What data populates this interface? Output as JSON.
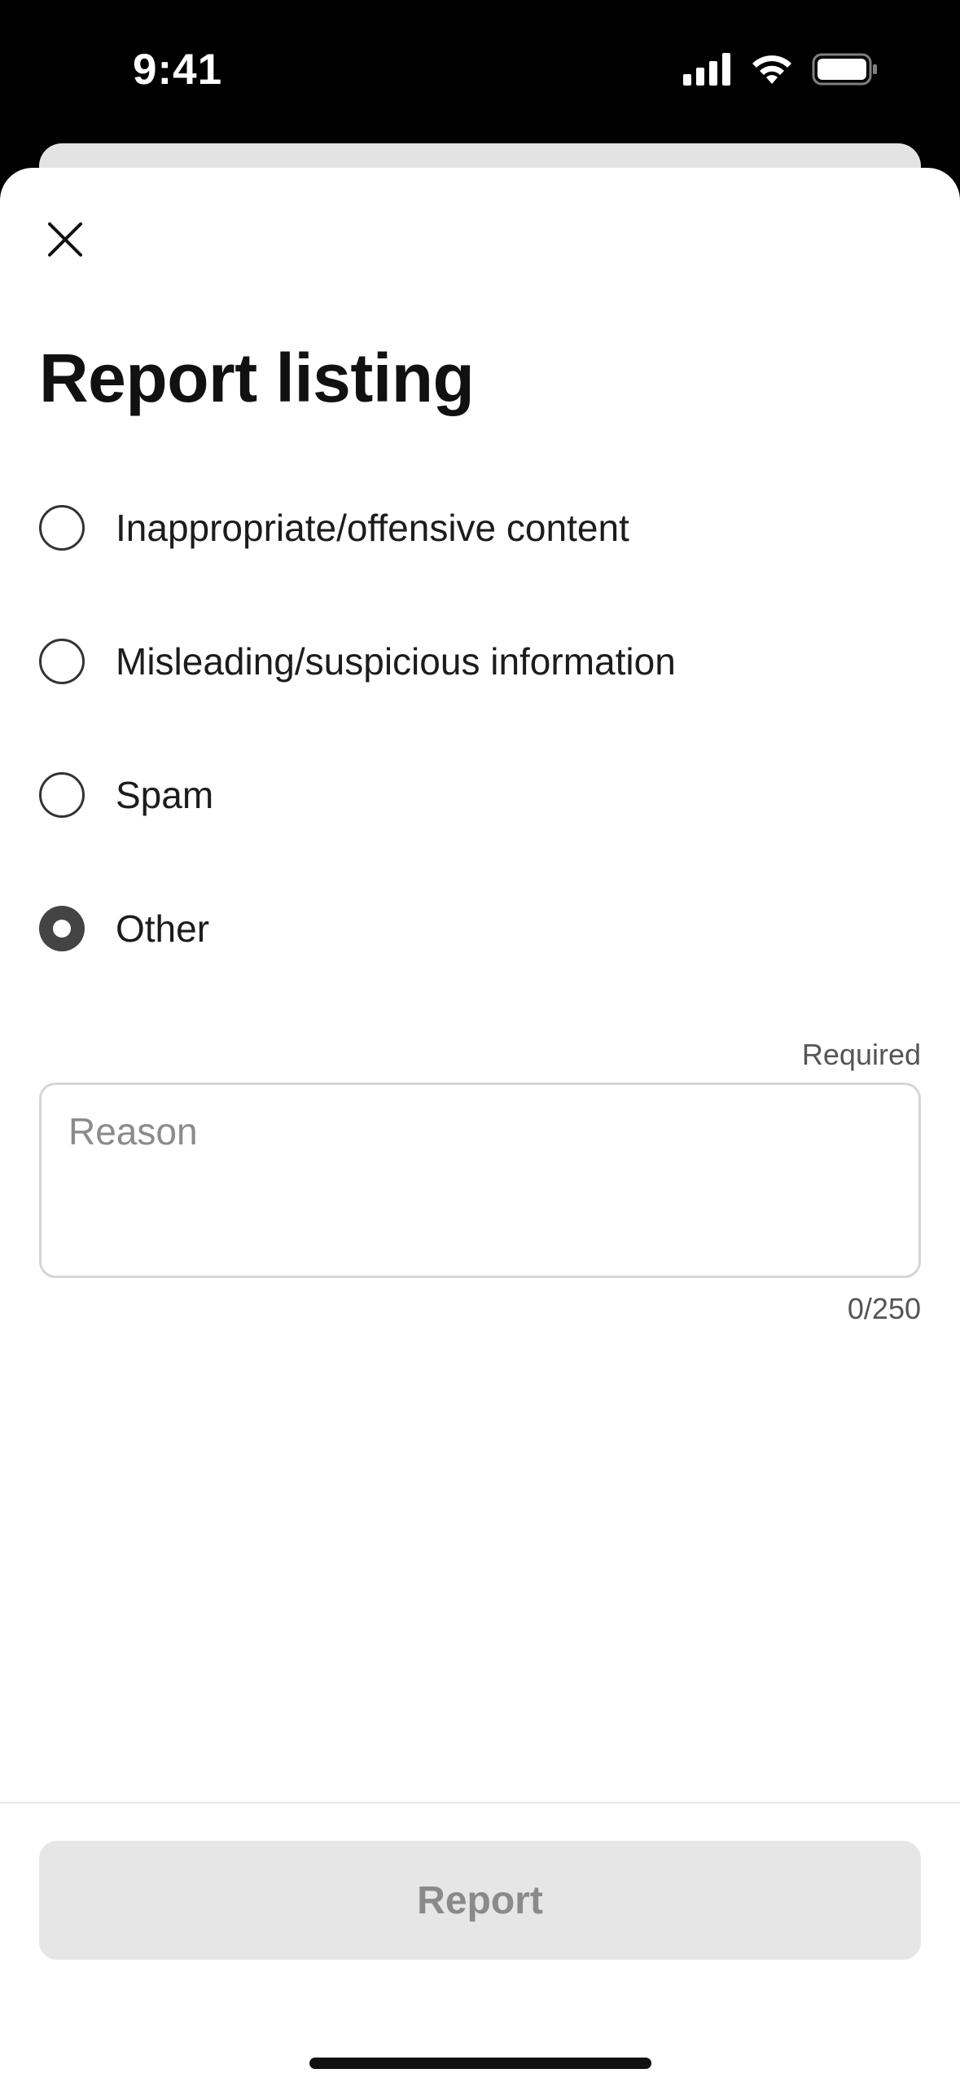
{
  "status_bar": {
    "time": "9:41",
    "icons": [
      "signal-icon",
      "wifi-icon",
      "battery-icon"
    ]
  },
  "sheet": {
    "close_icon": "close-icon",
    "title": "Report listing",
    "options": [
      {
        "label": "Inappropriate/offensive content",
        "selected": false
      },
      {
        "label": "Misleading/suspicious information",
        "selected": false
      },
      {
        "label": "Spam",
        "selected": false
      },
      {
        "label": "Other",
        "selected": true
      }
    ],
    "reason": {
      "required_label": "Required",
      "placeholder": "Reason",
      "value": "",
      "char_count": "0/250"
    },
    "report_button_label": "Report"
  },
  "colors": {
    "background": "#ffffff",
    "text": "#111111",
    "radio_selected": "#444444",
    "button_disabled_bg": "#e6e6e6",
    "button_disabled_text": "#8a8a8a"
  }
}
